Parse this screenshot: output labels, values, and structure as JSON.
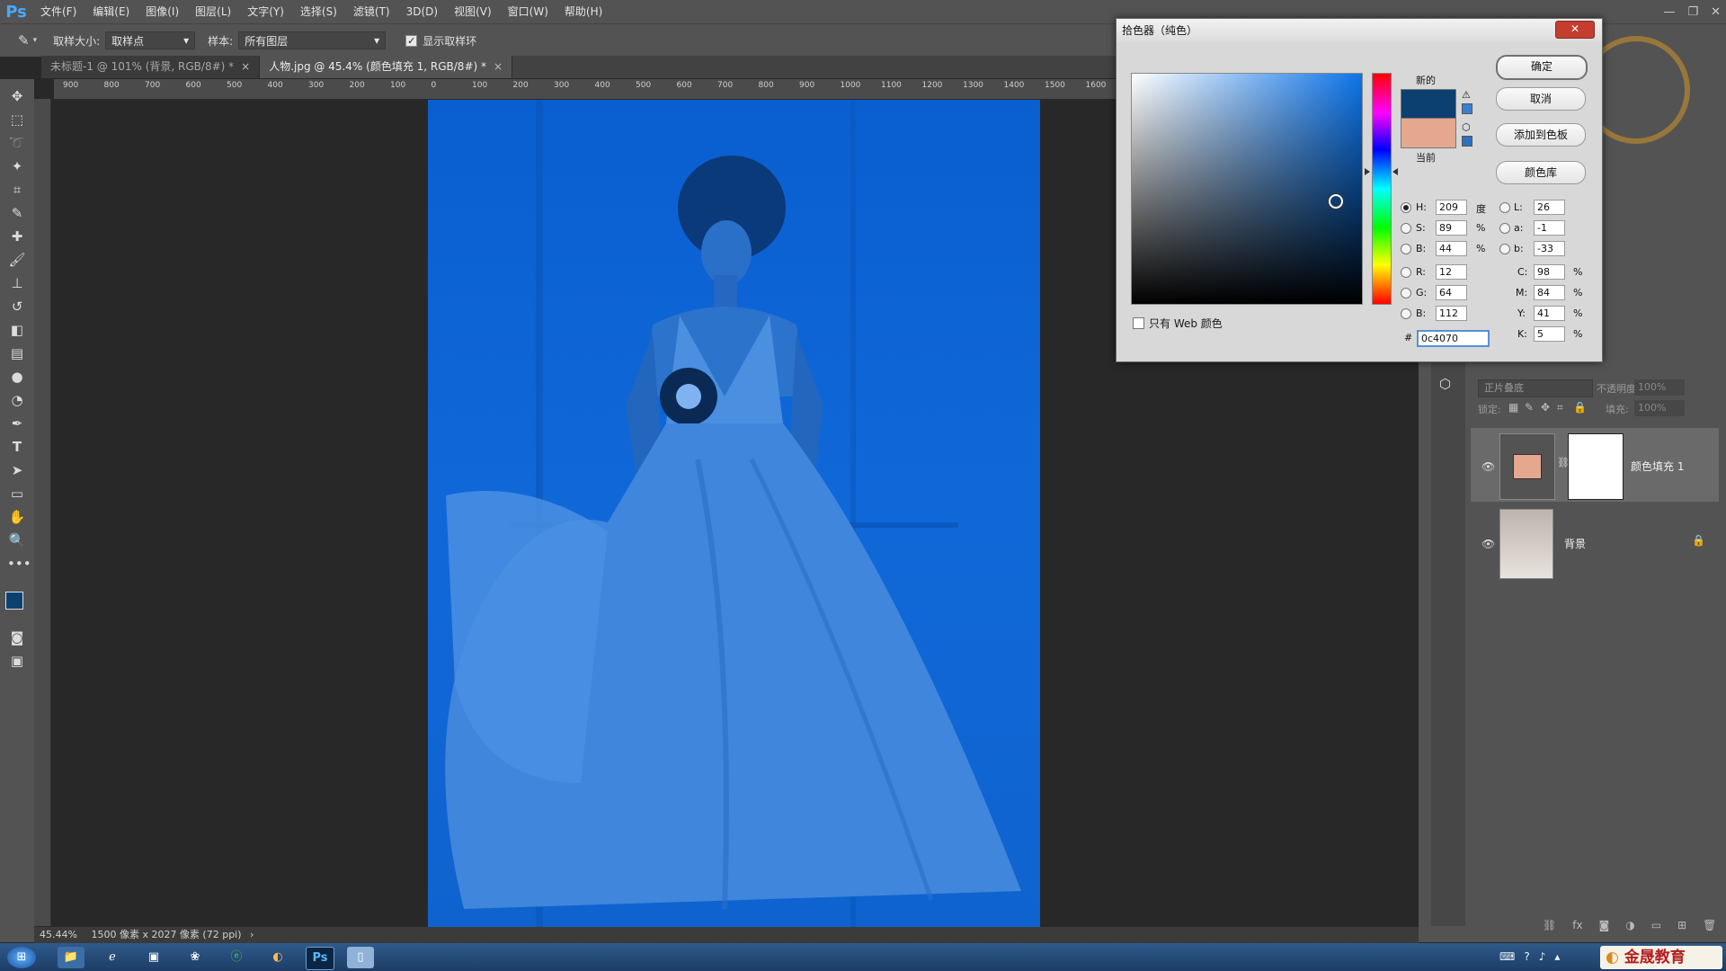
{
  "app": {
    "logo": "Ps"
  },
  "menu": [
    "文件(F)",
    "编辑(E)",
    "图像(I)",
    "图层(L)",
    "文字(Y)",
    "选择(S)",
    "滤镜(T)",
    "3D(D)",
    "视图(V)",
    "窗口(W)",
    "帮助(H)"
  ],
  "options": {
    "sample_size_label": "取样大小:",
    "sample_size_value": "取样点",
    "sample_label": "样本:",
    "sample_value": "所有图层",
    "show_ring_label": "显示取样环",
    "show_ring_checked": true
  },
  "tabs": [
    {
      "label": "未标题-1 @ 101% (背景, RGB/8#) *",
      "active": false
    },
    {
      "label": "人物.jpg @ 45.4% (颜色填充 1, RGB/8#) *",
      "active": true
    }
  ],
  "ruler_h": [
    "900",
    "800",
    "700",
    "600",
    "500",
    "400",
    "300",
    "200",
    "100",
    "0",
    "100",
    "200",
    "300",
    "400",
    "500",
    "600",
    "700",
    "800",
    "900",
    "1000",
    "1100",
    "1200",
    "1300",
    "1400",
    "1500",
    "1600"
  ],
  "status": {
    "zoom": "45.44%",
    "info": "1500 像素 x 2027 像素 (72 ppi)"
  },
  "dialog": {
    "title": "拾色器（纯色）",
    "close": "✕",
    "new_label": "新的",
    "current_label": "当前",
    "new_color": "#0c4070",
    "current_color": "#e5a88f",
    "buttons": {
      "ok": "确定",
      "cancel": "取消",
      "add_swatch": "添加到色板",
      "libraries": "颜色库"
    },
    "web_only_label": "只有 Web 颜色",
    "hsb": {
      "H": "209",
      "S": "89",
      "B": "44",
      "h_unit": "度",
      "s_unit": "%",
      "b_unit": "%"
    },
    "rgb": {
      "R": "12",
      "G": "64",
      "B": "112"
    },
    "lab": {
      "L": "26",
      "a": "-1",
      "b": "-33"
    },
    "cmyk": {
      "C": "98",
      "M": "84",
      "Y": "41",
      "K": "5",
      "unit": "%"
    },
    "hex": "0c4070"
  },
  "layers_panel": {
    "blend_mode": "正片叠底",
    "opacity_label": "不透明度:",
    "opacity_value": "100%",
    "lock_label": "锁定:",
    "fill_label": "填充:",
    "fill_value": "100%",
    "layers": [
      {
        "name": "颜色填充 1",
        "swatch": "#e5a88f"
      },
      {
        "name": "背景",
        "locked": true
      }
    ]
  },
  "taskbar": {
    "brand": "金晟教育"
  }
}
